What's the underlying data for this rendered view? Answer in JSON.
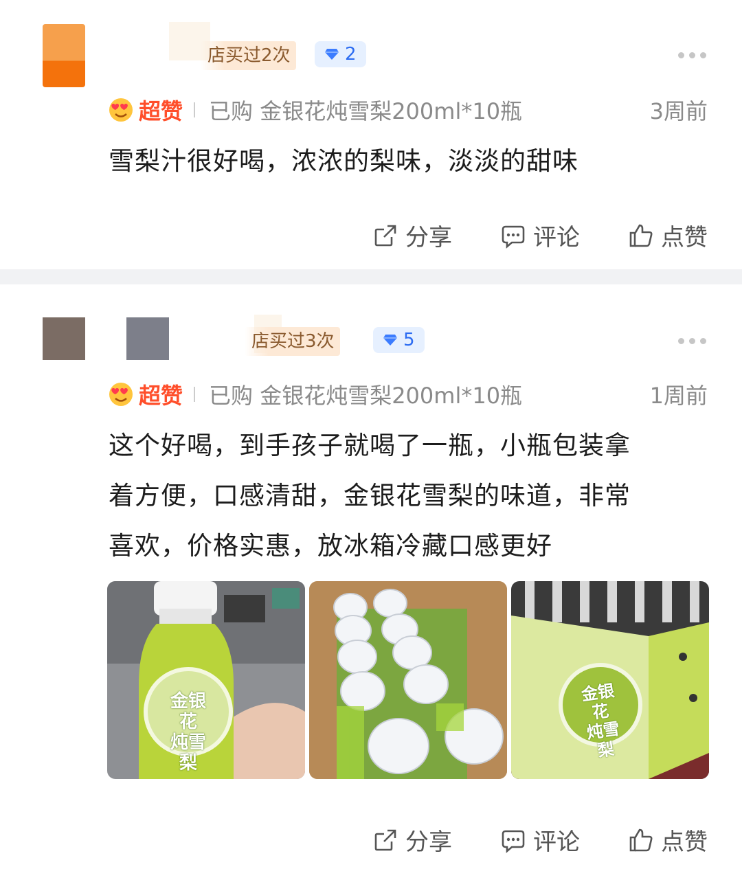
{
  "reviews": [
    {
      "buy_tag": "店买过2次",
      "level": "2",
      "rating": "超赞",
      "purchased": "已购 金银花炖雪梨200ml*10瓶",
      "time": "3周前",
      "text": "雪梨汁很好喝，浓浓的梨味，淡淡的甜味",
      "actions": {
        "share": "分享",
        "comment": "评论",
        "like": "点赞"
      }
    },
    {
      "buy_tag": "店买过3次",
      "level": "5",
      "rating": "超赞",
      "purchased": "已购 金银花炖雪梨200ml*10瓶",
      "time": "1周前",
      "text_lines": [
        "这个好喝，到手孩子就喝了一瓶，小瓶包装拿",
        "着方便，口感清甜，金银花雪梨的味道，非常",
        "喜欢，价格实惠，放冰箱冷藏口感更好"
      ],
      "photos": [
        {
          "label_line1": "金银花",
          "label_line2": "炖雪梨"
        },
        {
          "content": "bottles-in-box"
        },
        {
          "label_line1": "金银花",
          "label_line2": "炖雪梨"
        }
      ],
      "actions": {
        "share": "分享",
        "comment": "评论",
        "like": "点赞"
      }
    }
  ],
  "colors": {
    "rating": "#ff4e2a",
    "level_badge_bg": "#e6f0ff",
    "level_badge_text": "#2c6cf2",
    "divider": "#f1f2f4"
  },
  "icons": [
    "diamond-icon",
    "heart-eyes-icon",
    "share-icon",
    "comment-icon",
    "thumbs-up-icon",
    "more-icon"
  ]
}
